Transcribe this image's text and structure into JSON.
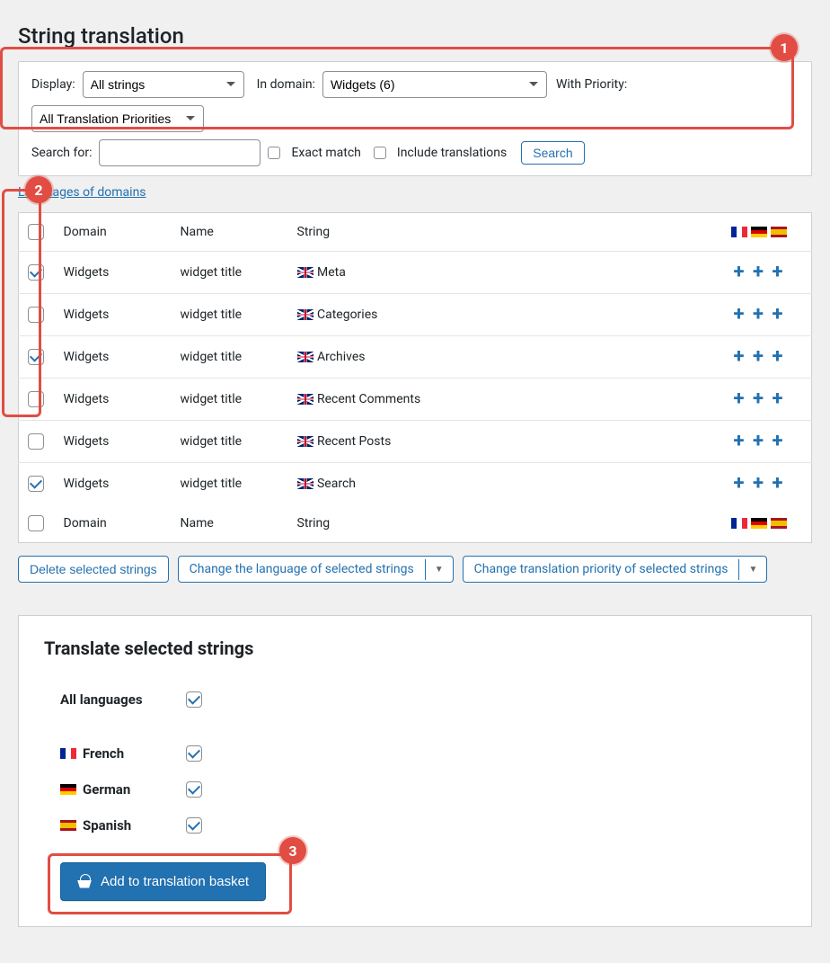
{
  "page_title": "String translation",
  "filter": {
    "display_label": "Display:",
    "display_value": "All strings",
    "domain_label": "In domain:",
    "domain_value": "Widgets (6)",
    "priority_label": "With Priority:",
    "priority_value": "All Translation Priorities",
    "search_label": "Search for:",
    "exact_match_label": "Exact match",
    "include_translations_label": "Include translations",
    "search_button": "Search"
  },
  "links": {
    "languages_of_domains": "Languages of domains"
  },
  "table": {
    "headers": {
      "domain": "Domain",
      "name": "Name",
      "string": "String"
    },
    "rows": [
      {
        "checked": true,
        "domain": "Widgets",
        "name": "widget title",
        "string": "Meta"
      },
      {
        "checked": false,
        "domain": "Widgets",
        "name": "widget title",
        "string": "Categories"
      },
      {
        "checked": true,
        "domain": "Widgets",
        "name": "widget title",
        "string": "Archives"
      },
      {
        "checked": false,
        "domain": "Widgets",
        "name": "widget title",
        "string": "Recent Comments"
      },
      {
        "checked": false,
        "domain": "Widgets",
        "name": "widget title",
        "string": "Recent Posts"
      },
      {
        "checked": true,
        "domain": "Widgets",
        "name": "widget title",
        "string": "Search"
      }
    ]
  },
  "actions": {
    "delete": "Delete selected strings",
    "change_language": "Change the language of selected strings",
    "change_priority": "Change translation priority of selected strings"
  },
  "translate_panel": {
    "heading": "Translate selected strings",
    "all_languages": "All languages",
    "languages": [
      {
        "name": "French",
        "flag": "fr",
        "checked": true
      },
      {
        "name": "German",
        "flag": "de",
        "checked": true
      },
      {
        "name": "Spanish",
        "flag": "es",
        "checked": true
      }
    ],
    "add_button": "Add to translation basket"
  },
  "annotations": {
    "a1": "1",
    "a2": "2",
    "a3": "3"
  }
}
